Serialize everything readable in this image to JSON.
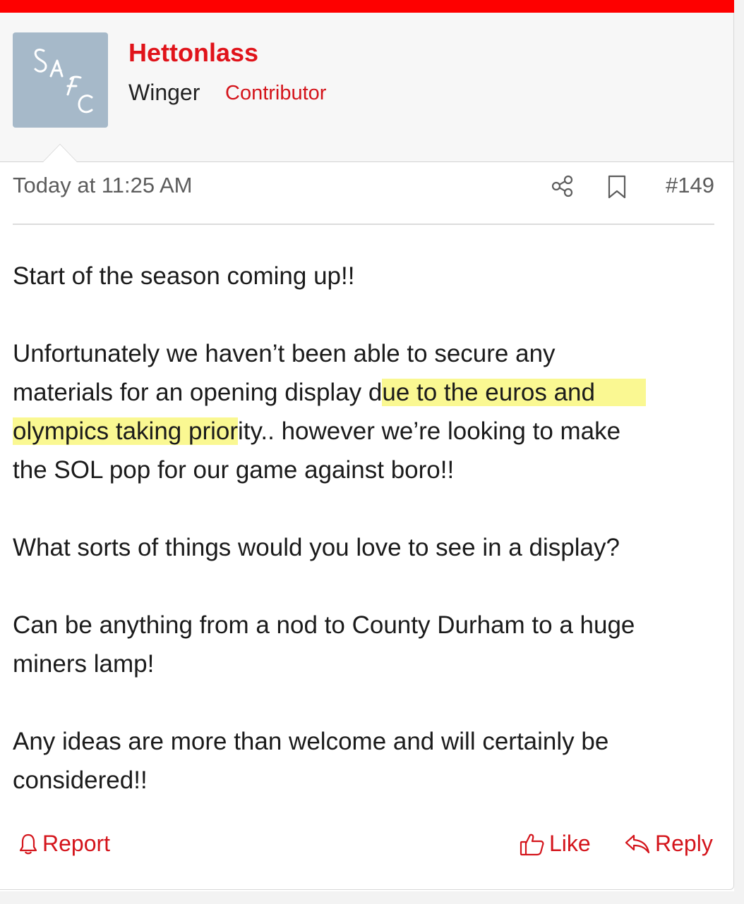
{
  "author": {
    "username": "Hettonlass",
    "title": "Winger",
    "role": "Contributor",
    "avatar_text": "SAFC"
  },
  "post": {
    "timestamp": "Today at 11:25 AM",
    "number": "#149",
    "paragraphs": {
      "p1": "Start of the season coming up!!",
      "p2_l1": "Unfortunately we haven’t been able to secure any",
      "p2_l2_a": "materials for an opening display d",
      "p2_l2_b": "ue to the euros and",
      "p2_l3_a": "olympics taking prior",
      "p2_l3_b": "ity.. however we’re looking to make",
      "p2_l4": "the SOL pop for our game against boro!!",
      "p3": "What sorts of things would you love to see in a display?",
      "p4_l1": "Can be anything from a nod to County Durham to a huge",
      "p4_l2": "miners lamp!",
      "p5_l1": "Any ideas are more than welcome and will certainly be",
      "p5_l2": "considered!!"
    }
  },
  "actions": {
    "report": "Report",
    "like": "Like",
    "reply": "Reply"
  },
  "icons": {
    "share": "share-icon",
    "bookmark": "bookmark-icon",
    "report": "bell-icon",
    "like": "thumbs-up-icon",
    "reply": "reply-arrow-icon"
  },
  "colors": {
    "accent": "#e0131a",
    "highlight": "#f8f56e",
    "top_bar": "#fe0000"
  }
}
